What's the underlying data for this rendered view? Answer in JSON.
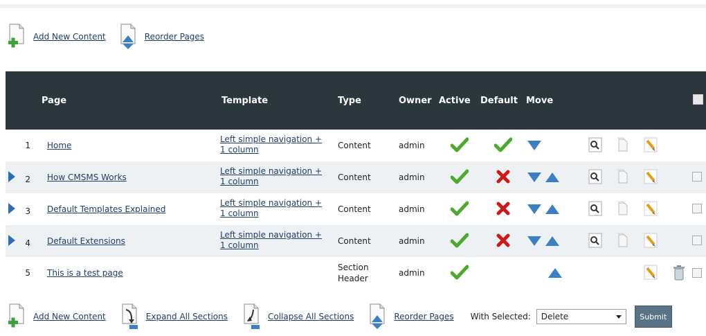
{
  "top_links": {
    "add_new_content": "Add New Content",
    "reorder_pages": "Reorder Pages"
  },
  "table": {
    "headers": {
      "page": "Page",
      "template": "Template",
      "type": "Type",
      "owner": "Owner",
      "active": "Active",
      "default": "Default",
      "move": "Move"
    },
    "rows": [
      {
        "num": "1",
        "page": "Home",
        "template_line1": "Left simple navigation +",
        "template_line2": "1 column",
        "type_line1": "Content",
        "type_line2": "",
        "owner": "admin"
      },
      {
        "num": "2",
        "page": "How CMSMS Works",
        "template_line1": "Left simple navigation +",
        "template_line2": "1 column",
        "type_line1": "Content",
        "type_line2": "",
        "owner": "admin"
      },
      {
        "num": "3",
        "page": "Default Templates Explained",
        "template_line1": "Left simple navigation +",
        "template_line2": "1 column",
        "type_line1": "Content",
        "type_line2": "",
        "owner": "admin"
      },
      {
        "num": "4",
        "page": "Default Extensions",
        "template_line1": "Left simple navigation +",
        "template_line2": "1 column",
        "type_line1": "Content",
        "type_line2": "",
        "owner": "admin"
      },
      {
        "num": "5",
        "page": "This is a test page",
        "template_line1": "",
        "template_line2": "",
        "type_line1": "Section",
        "type_line2": "Header",
        "owner": "admin"
      }
    ]
  },
  "bottom_bar": {
    "add_new_content": "Add New Content",
    "expand_all_sections": "Expand All Sections",
    "collapse_all_sections": "Collapse All Sections",
    "reorder_pages": "Reorder Pages",
    "with_selected_label": "With Selected:",
    "with_selected_value": "Delete",
    "submit_label": "Submit"
  },
  "colors": {
    "header_bg": "#2b373d",
    "link": "#1e3f66",
    "check_green": "#4caa2c",
    "cross_red": "#d01818",
    "arrow_blue": "#3b7fc4"
  }
}
